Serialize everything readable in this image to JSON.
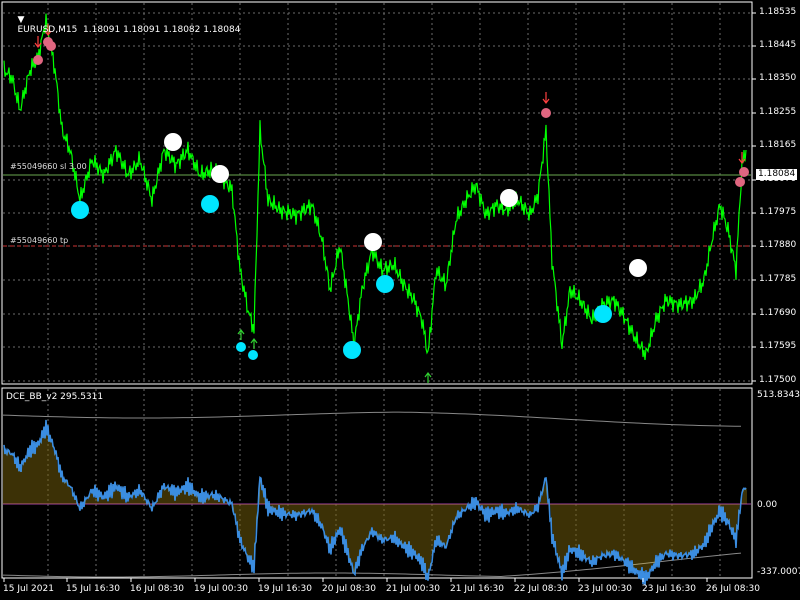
{
  "window": {
    "symbol_line": "EURUSD,M15  1.18091 1.18091 1.18082 1.18084",
    "menu_arrow": "triangle-down-icon"
  },
  "main_chart": {
    "price_ticks": [
      "1.18535",
      "1.18445",
      "1.18350",
      "1.18255",
      "1.18165",
      "1.18070",
      "1.17975",
      "1.17880",
      "1.17785",
      "1.17690",
      "1.17595",
      "1.17500"
    ],
    "current_price": "1.18084",
    "order_lines": [
      {
        "label": "#55049660  sl 3.00",
        "color": "#6aa84f"
      },
      {
        "label": "#55049660  tp",
        "color": "#cc3333"
      }
    ],
    "series_color": "#00ff00",
    "signal_markers": {
      "cyan": "#00e5ff",
      "white": "#ffffff",
      "pink": "#e06680"
    }
  },
  "indicator": {
    "title": "DCE_BB_v2 295.5311",
    "axis_top": "513.8343",
    "axis_zero": "0.00",
    "axis_bottom": "-337.0007",
    "line_color": "#3b8de0",
    "hist_color": "#f0c419",
    "band_color": "#888888",
    "zero_color": "#a040a0"
  },
  "time_axis": [
    "15 Jul 2021",
    "15 Jul 16:30",
    "16 Jul 08:30",
    "19 Jul 00:30",
    "19 Jul 16:30",
    "20 Jul 08:30",
    "21 Jul 00:30",
    "21 Jul 16:30",
    "22 Jul 08:30",
    "23 Jul 00:30",
    "23 Jul 16:30",
    "26 Jul 08:30"
  ]
}
